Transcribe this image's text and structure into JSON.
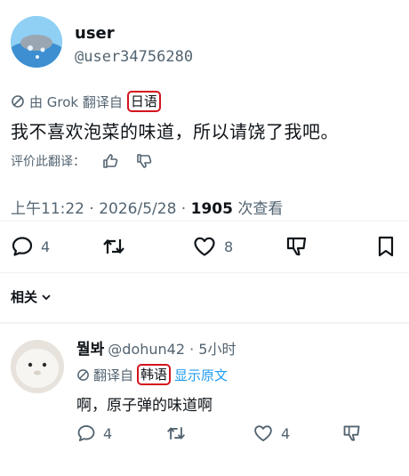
{
  "tweet": {
    "display_name": "user",
    "handle": "@user34756280",
    "translation": {
      "prefix": "由 Grok 翻译自",
      "language": "日语"
    },
    "text": "我不喜欢泡菜的味道，所以请饶了我吧。",
    "rate_label": "评价此翻译：",
    "meta": {
      "time": "上午11:22",
      "sep": " · ",
      "date": "2026/5/28",
      "views_count": "1905",
      "views_label": "次查看"
    },
    "actions": {
      "reply_count": "4",
      "like_count": "8"
    }
  },
  "related_label": "相关",
  "reply": {
    "display_name": "뭘봐",
    "handle_time": "@dohun42 · 5小时",
    "translation_prefix": "翻译自",
    "language": "韩语",
    "show_original": "显示原文",
    "text": "啊，原子弹的味道啊",
    "actions": {
      "reply_count": "4",
      "like_count": "4"
    }
  },
  "colors": {
    "highlight_box": "#d2141e",
    "link": "#1d9bf0",
    "secondary_text": "#536471"
  }
}
